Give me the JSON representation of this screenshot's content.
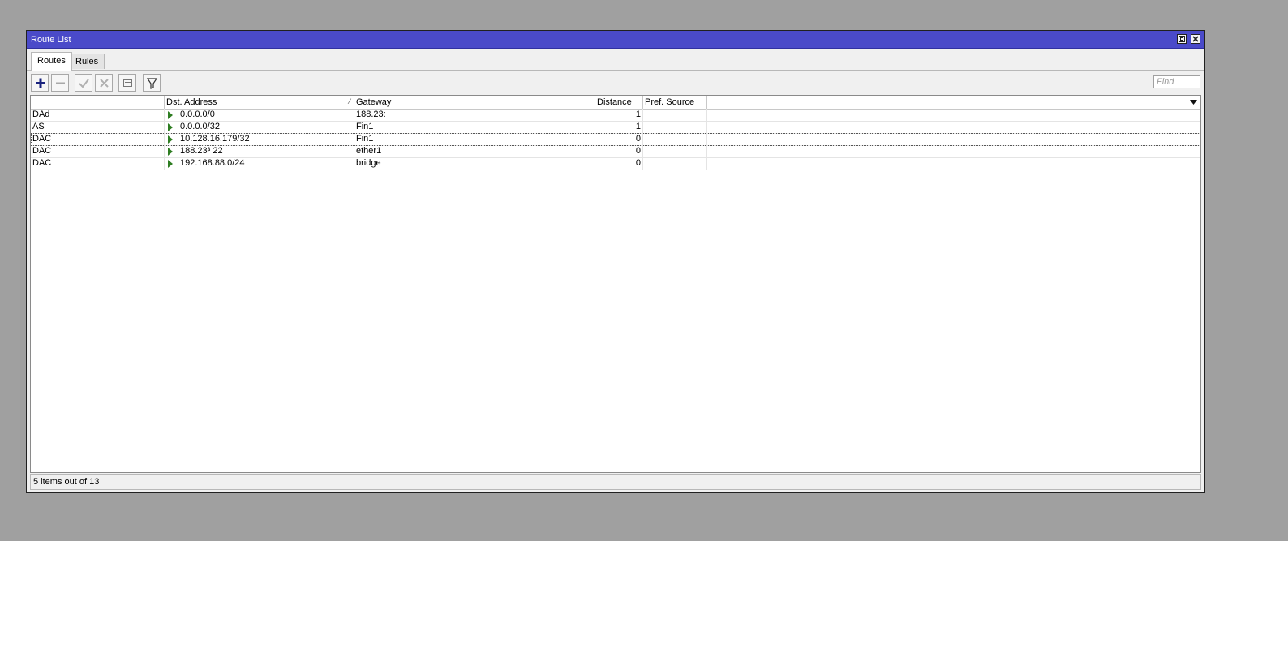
{
  "window": {
    "title": "Route List"
  },
  "tabs": [
    {
      "label": "Routes",
      "active": true
    },
    {
      "label": "Rules",
      "active": false
    }
  ],
  "toolbar": {
    "icons": [
      "add-icon",
      "remove-icon",
      "enable-icon",
      "disable-icon",
      "comment-icon",
      "filter-icon"
    ],
    "find_placeholder": "Find"
  },
  "table": {
    "columns": [
      "",
      "Dst. Address",
      "Gateway",
      "Distance",
      "Pref. Source"
    ],
    "sort_column": "Dst. Address",
    "rows": [
      {
        "flags": "DAd",
        "dst": "0.0.0.0/0",
        "gateway": "188.23:",
        "distance": "1",
        "pref_source": ""
      },
      {
        "flags": "AS",
        "dst": "0.0.0.0/32",
        "gateway": "Fin1",
        "distance": "1",
        "pref_source": ""
      },
      {
        "flags": "DAC",
        "dst": "10.128.16.179/32",
        "gateway": "Fin1",
        "distance": "0",
        "pref_source": "",
        "selected": true
      },
      {
        "flags": "DAC",
        "dst": "188.23³        22",
        "gateway": "ether1",
        "distance": "0",
        "pref_source": ""
      },
      {
        "flags": "DAC",
        "dst": "192.168.88.0/24",
        "gateway": "bridge",
        "distance": "0",
        "pref_source": ""
      }
    ]
  },
  "status": {
    "text": "5 items out of 13"
  },
  "colors": {
    "titlebar": "#4a4ac9",
    "desktop": "#a0a0a0",
    "route_arrow": "#2e7d22",
    "add_icon": "#1a237e"
  }
}
